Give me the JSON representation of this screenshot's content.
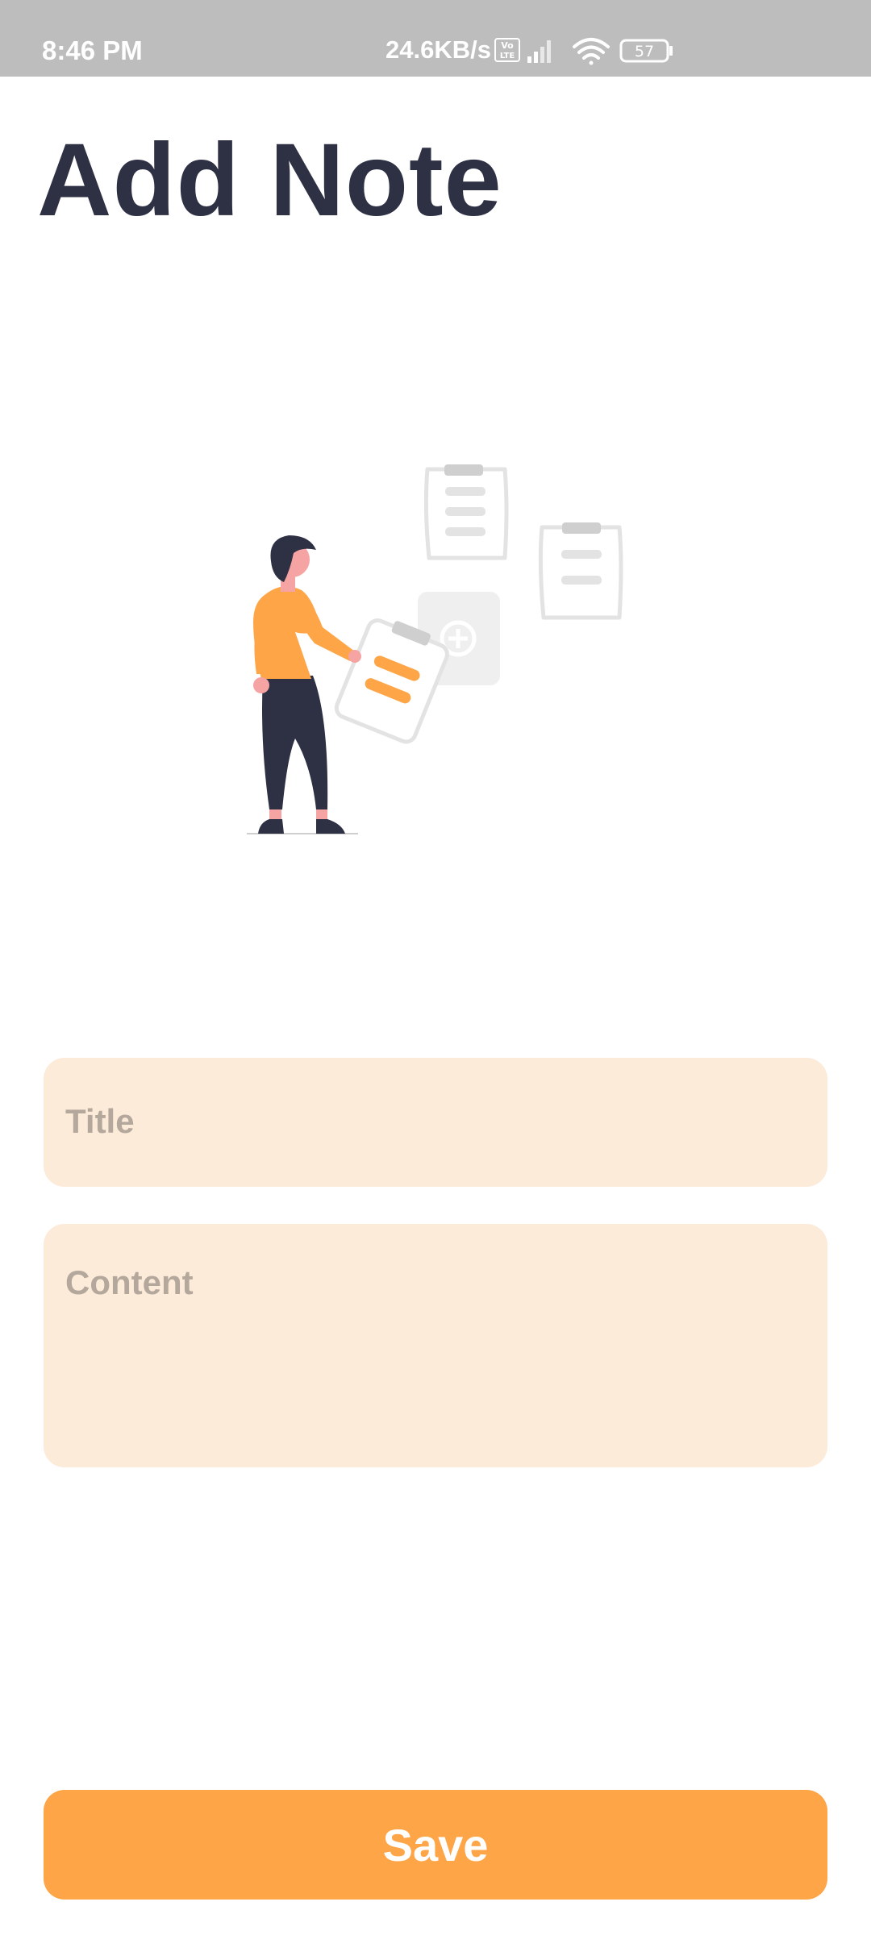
{
  "status_bar": {
    "time": "8:46 PM",
    "network_speed": "24.6KB/s",
    "volte_label": "Vo LTE",
    "battery_level": "57",
    "icons": [
      "volte-icon",
      "signal-icon",
      "wifi-icon",
      "battery-icon"
    ]
  },
  "header": {
    "title": "Add Note"
  },
  "illustration": {
    "icon": "person-adding-notes-illustration",
    "accent_color": "#fea548",
    "dark_color": "#2e3044",
    "muted_color": "#e0e0e0"
  },
  "form": {
    "title_placeholder": "Title",
    "title_value": "",
    "content_placeholder": "Content",
    "content_value": "",
    "field_background": "#fdebda"
  },
  "actions": {
    "save_label": "Save",
    "save_color": "#fea548"
  }
}
